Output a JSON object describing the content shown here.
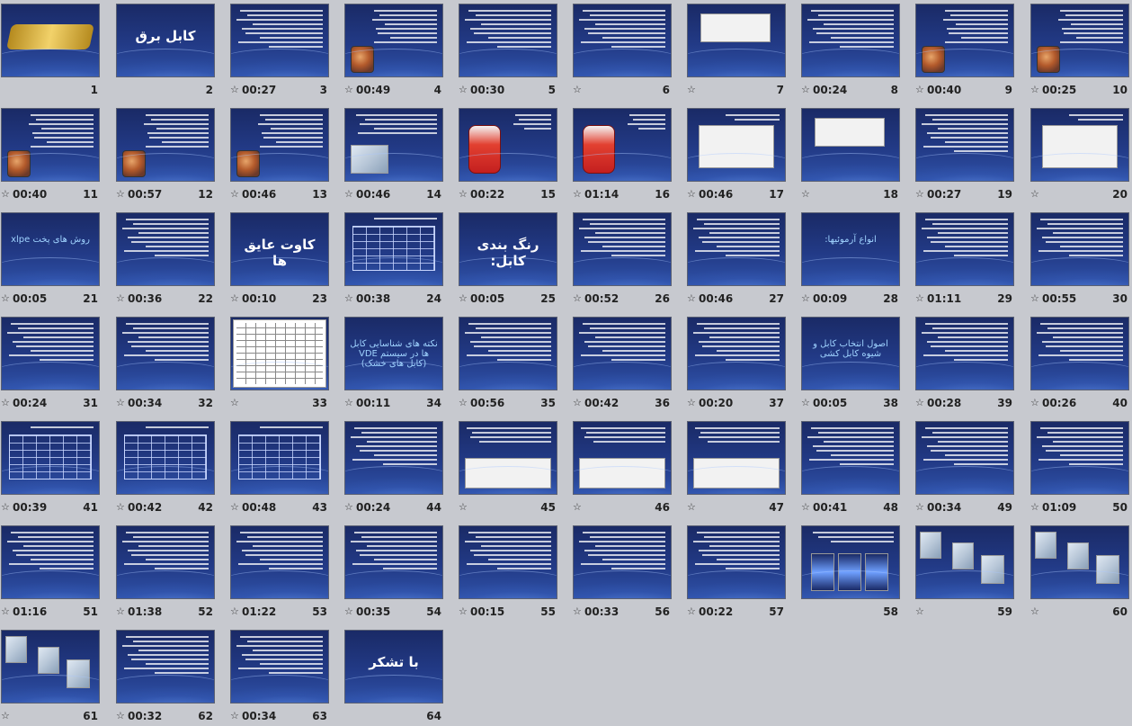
{
  "slides": [
    {
      "number": "1",
      "timing": "",
      "has_transition": false,
      "kind": "logo",
      "title": ""
    },
    {
      "number": "2",
      "timing": "",
      "has_transition": false,
      "kind": "title",
      "title": "کابل برق"
    },
    {
      "number": "3",
      "timing": "00:27",
      "has_transition": true,
      "kind": "text",
      "title": ""
    },
    {
      "number": "4",
      "timing": "00:49",
      "has_transition": true,
      "kind": "text-cable",
      "title": ""
    },
    {
      "number": "5",
      "timing": "00:30",
      "has_transition": true,
      "kind": "text",
      "title": ""
    },
    {
      "number": "6",
      "timing": "",
      "has_transition": true,
      "kind": "text",
      "title": ""
    },
    {
      "number": "7",
      "timing": "",
      "has_transition": true,
      "kind": "image-top",
      "title": ""
    },
    {
      "number": "8",
      "timing": "00:24",
      "has_transition": true,
      "kind": "text",
      "title": ""
    },
    {
      "number": "9",
      "timing": "00:40",
      "has_transition": true,
      "kind": "text-cable",
      "title": ""
    },
    {
      "number": "10",
      "timing": "00:25",
      "has_transition": true,
      "kind": "text-cable",
      "title": ""
    },
    {
      "number": "11",
      "timing": "00:40",
      "has_transition": true,
      "kind": "text-cable",
      "title": ""
    },
    {
      "number": "12",
      "timing": "00:57",
      "has_transition": true,
      "kind": "text-cable",
      "title": ""
    },
    {
      "number": "13",
      "timing": "00:46",
      "has_transition": true,
      "kind": "text-cable",
      "title": ""
    },
    {
      "number": "14",
      "timing": "00:46",
      "has_transition": true,
      "kind": "text-photo",
      "title": ""
    },
    {
      "number": "15",
      "timing": "00:22",
      "has_transition": true,
      "kind": "red-cable",
      "title": ""
    },
    {
      "number": "16",
      "timing": "01:14",
      "has_transition": true,
      "kind": "red-cable",
      "title": ""
    },
    {
      "number": "17",
      "timing": "00:46",
      "has_transition": true,
      "kind": "image-box",
      "title": ""
    },
    {
      "number": "18",
      "timing": "",
      "has_transition": true,
      "kind": "image-top",
      "title": ""
    },
    {
      "number": "19",
      "timing": "00:27",
      "has_transition": true,
      "kind": "text",
      "title": ""
    },
    {
      "number": "20",
      "timing": "",
      "has_transition": true,
      "kind": "image-box",
      "title": ""
    },
    {
      "number": "21",
      "timing": "00:05",
      "has_transition": true,
      "kind": "title",
      "title": "روش های پخت xlpe"
    },
    {
      "number": "22",
      "timing": "00:36",
      "has_transition": true,
      "kind": "text",
      "title": ""
    },
    {
      "number": "23",
      "timing": "00:10",
      "has_transition": true,
      "kind": "title",
      "title": "کاوت عایق ها"
    },
    {
      "number": "24",
      "timing": "00:38",
      "has_transition": true,
      "kind": "blue-table",
      "title": ""
    },
    {
      "number": "25",
      "timing": "00:05",
      "has_transition": true,
      "kind": "title",
      "title": "رنگ بندی کابل:"
    },
    {
      "number": "26",
      "timing": "00:52",
      "has_transition": true,
      "kind": "text",
      "title": ""
    },
    {
      "number": "27",
      "timing": "00:46",
      "has_transition": true,
      "kind": "text",
      "title": ""
    },
    {
      "number": "28",
      "timing": "00:09",
      "has_transition": true,
      "kind": "title",
      "title": "انواع آرموئیها:"
    },
    {
      "number": "29",
      "timing": "01:11",
      "has_transition": true,
      "kind": "text",
      "title": ""
    },
    {
      "number": "30",
      "timing": "00:55",
      "has_transition": true,
      "kind": "text",
      "title": ""
    },
    {
      "number": "31",
      "timing": "00:24",
      "has_transition": true,
      "kind": "text",
      "title": ""
    },
    {
      "number": "32",
      "timing": "00:34",
      "has_transition": true,
      "kind": "text",
      "title": ""
    },
    {
      "number": "33",
      "timing": "",
      "has_transition": true,
      "kind": "table",
      "title": ""
    },
    {
      "number": "34",
      "timing": "00:11",
      "has_transition": true,
      "kind": "title",
      "title": "نکته های شناسایی کابل ها در سیستم VDE (کابل های خشک)"
    },
    {
      "number": "35",
      "timing": "00:56",
      "has_transition": true,
      "kind": "text",
      "title": ""
    },
    {
      "number": "36",
      "timing": "00:42",
      "has_transition": true,
      "kind": "text",
      "title": ""
    },
    {
      "number": "37",
      "timing": "00:20",
      "has_transition": true,
      "kind": "text",
      "title": ""
    },
    {
      "number": "38",
      "timing": "00:05",
      "has_transition": true,
      "kind": "title",
      "title": "اصول انتخاب کابل و شیوه کابل کشی"
    },
    {
      "number": "39",
      "timing": "00:28",
      "has_transition": true,
      "kind": "text",
      "title": ""
    },
    {
      "number": "40",
      "timing": "00:26",
      "has_transition": true,
      "kind": "text",
      "title": ""
    },
    {
      "number": "41",
      "timing": "00:39",
      "has_transition": true,
      "kind": "blue-table",
      "title": ""
    },
    {
      "number": "42",
      "timing": "00:42",
      "has_transition": true,
      "kind": "blue-table",
      "title": ""
    },
    {
      "number": "43",
      "timing": "00:48",
      "has_transition": true,
      "kind": "blue-table",
      "title": ""
    },
    {
      "number": "44",
      "timing": "00:24",
      "has_transition": true,
      "kind": "text",
      "title": ""
    },
    {
      "number": "45",
      "timing": "",
      "has_transition": true,
      "kind": "image-bottom",
      "title": ""
    },
    {
      "number": "46",
      "timing": "",
      "has_transition": true,
      "kind": "image-bottom",
      "title": ""
    },
    {
      "number": "47",
      "timing": "",
      "has_transition": true,
      "kind": "image-bottom",
      "title": ""
    },
    {
      "number": "48",
      "timing": "00:41",
      "has_transition": true,
      "kind": "text",
      "title": ""
    },
    {
      "number": "49",
      "timing": "00:34",
      "has_transition": true,
      "kind": "text",
      "title": ""
    },
    {
      "number": "50",
      "timing": "01:09",
      "has_transition": true,
      "kind": "text",
      "title": ""
    },
    {
      "number": "51",
      "timing": "01:16",
      "has_transition": true,
      "kind": "text",
      "title": ""
    },
    {
      "number": "52",
      "timing": "01:38",
      "has_transition": true,
      "kind": "text",
      "title": ""
    },
    {
      "number": "53",
      "timing": "01:22",
      "has_transition": true,
      "kind": "text",
      "title": ""
    },
    {
      "number": "54",
      "timing": "00:35",
      "has_transition": true,
      "kind": "text",
      "title": ""
    },
    {
      "number": "55",
      "timing": "00:15",
      "has_transition": true,
      "kind": "text",
      "title": ""
    },
    {
      "number": "56",
      "timing": "00:33",
      "has_transition": true,
      "kind": "text",
      "title": ""
    },
    {
      "number": "57",
      "timing": "00:22",
      "has_transition": true,
      "kind": "text",
      "title": ""
    },
    {
      "number": "58",
      "timing": "",
      "has_transition": false,
      "kind": "photo-strip",
      "title": ""
    },
    {
      "number": "59",
      "timing": "",
      "has_transition": true,
      "kind": "photo-scatter",
      "title": ""
    },
    {
      "number": "60",
      "timing": "",
      "has_transition": true,
      "kind": "photo-scatter",
      "title": ""
    },
    {
      "number": "61",
      "timing": "",
      "has_transition": true,
      "kind": "photo-scatter",
      "title": ""
    },
    {
      "number": "62",
      "timing": "00:32",
      "has_transition": true,
      "kind": "text",
      "title": ""
    },
    {
      "number": "63",
      "timing": "00:34",
      "has_transition": true,
      "kind": "text",
      "title": ""
    },
    {
      "number": "64",
      "timing": "",
      "has_transition": false,
      "kind": "title",
      "title": "با تشکر"
    }
  ],
  "icons": {
    "transition": "star-transition-icon"
  },
  "colors": {
    "background": "#c7c9cf",
    "slide_blue": "#223a86",
    "title_text": "#ffffff",
    "accent_cyan": "#9fd3ff"
  }
}
